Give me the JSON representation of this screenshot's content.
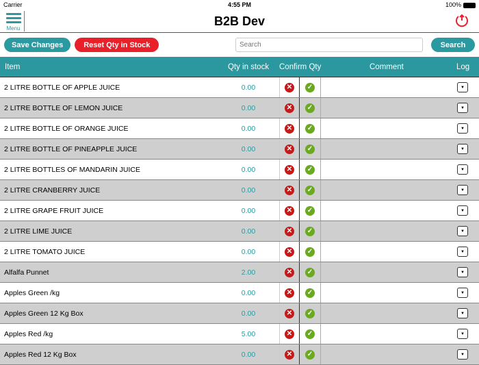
{
  "status": {
    "carrier": "Carrier",
    "time": "4:55 PM",
    "battery": "100%"
  },
  "nav": {
    "menu_label": "Menu",
    "title": "B2B Dev"
  },
  "toolbar": {
    "save": "Save Changes",
    "reset": "Reset Qty in Stock",
    "search_placeholder": "Search",
    "search_button": "Search"
  },
  "columns": {
    "item": "Item",
    "qty": "Qty in stock",
    "confirm": "Confirm Qty",
    "comment": "Comment",
    "log": "Log"
  },
  "rows": [
    {
      "name": "2 LITRE  BOTTLE OF APPLE JUICE",
      "qty": "0.00"
    },
    {
      "name": "2 LITRE BOTTLE OF LEMON JUICE",
      "qty": "0.00"
    },
    {
      "name": "2 LITRE BOTTLE OF ORANGE JUICE",
      "qty": "0.00"
    },
    {
      "name": "2 LITRE BOTTLE OF PINEAPPLE JUICE",
      "qty": "0.00"
    },
    {
      "name": "2 LITRE BOTTLES OF MANDARIN JUICE",
      "qty": "0.00"
    },
    {
      "name": "2 LITRE CRANBERRY JUICE",
      "qty": "0.00"
    },
    {
      "name": "2 LITRE GRAPE FRUIT JUICE",
      "qty": "0.00"
    },
    {
      "name": "2 LITRE LIME JUICE",
      "qty": "0.00"
    },
    {
      "name": "2 LITRE TOMATO JUICE",
      "qty": "0.00"
    },
    {
      "name": "Alfalfa Punnet",
      "qty": "2.00"
    },
    {
      "name": "Apples Green /kg",
      "qty": "0.00"
    },
    {
      "name": "Apples Green 12 Kg Box",
      "qty": "0.00"
    },
    {
      "name": "Apples Red /kg",
      "qty": "5.00"
    },
    {
      "name": "Apples Red 12 Kg Box",
      "qty": "0.00"
    }
  ]
}
